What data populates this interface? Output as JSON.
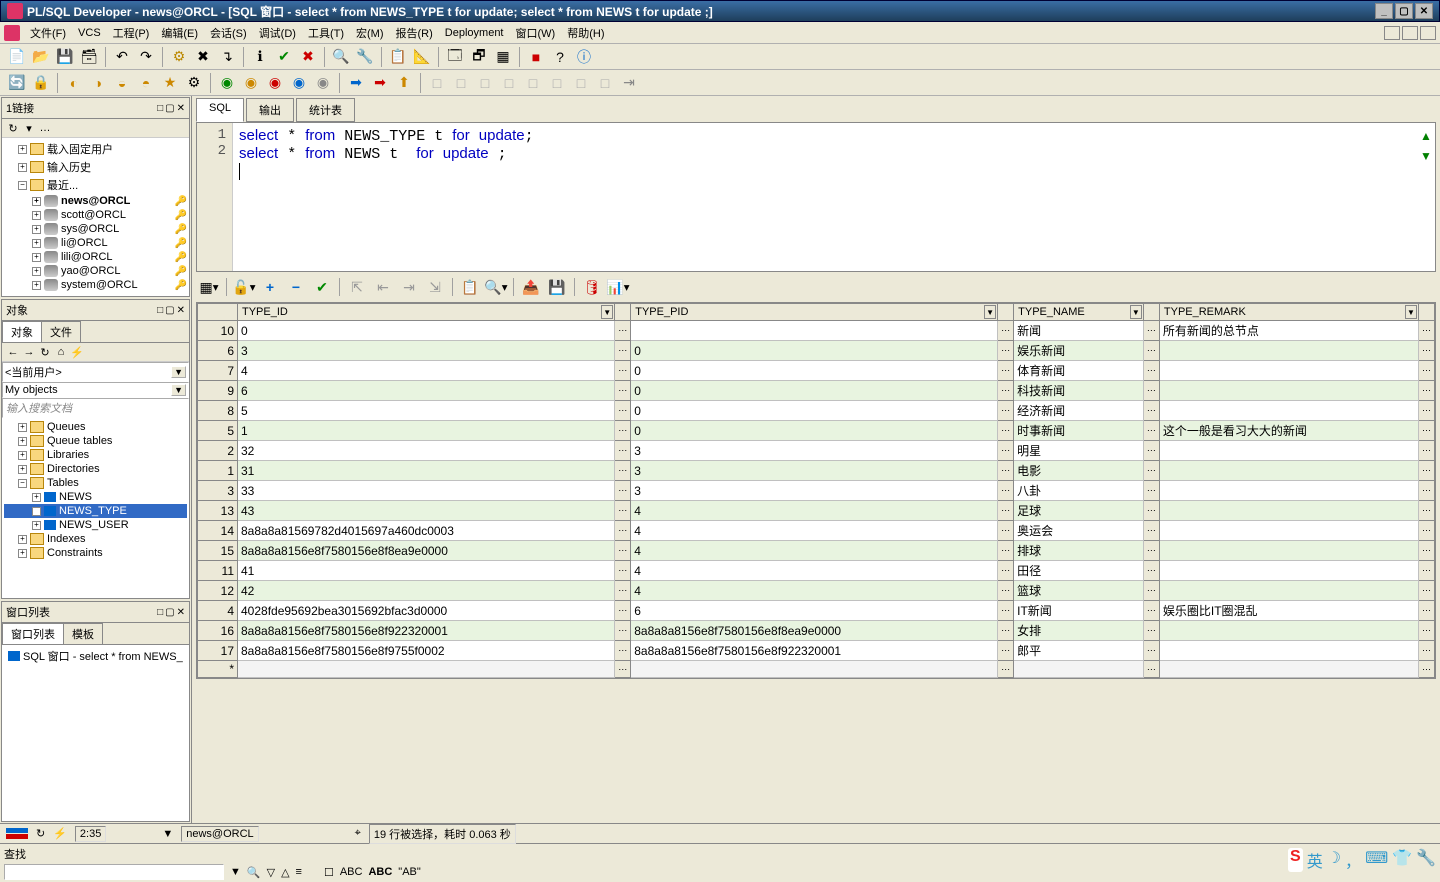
{
  "title": "PL/SQL Developer - news@ORCL - [SQL 窗口 - select * from NEWS_TYPE t for update; select * from NEWS t for update ;]",
  "menu": [
    "文件(F)",
    "VCS",
    "工程(P)",
    "编辑(E)",
    "会话(S)",
    "调试(D)",
    "工具(T)",
    "宏(M)",
    "报告(R)",
    "Deployment",
    "窗口(W)",
    "帮助(H)"
  ],
  "left": {
    "conn_title": "1链接",
    "conn_items": [
      {
        "label": "载入固定用户",
        "type": "folder"
      },
      {
        "label": "输入历史",
        "type": "folder"
      },
      {
        "label": "最近...",
        "type": "folder",
        "expanded": true,
        "children": [
          {
            "label": "news@ORCL",
            "bold": true,
            "key": true
          },
          {
            "label": "scott@ORCL",
            "key": true
          },
          {
            "label": "sys@ORCL",
            "key": true
          },
          {
            "label": "li@ORCL",
            "key": true
          },
          {
            "label": "lili@ORCL",
            "key": true
          },
          {
            "label": "yao@ORCL",
            "key": true
          },
          {
            "label": "system@ORCL",
            "key": true
          }
        ]
      }
    ],
    "obj_title": "对象",
    "obj_tabs": [
      "对象",
      "文件"
    ],
    "user_combo": "<当前用户>",
    "filter_combo": "My objects",
    "search_ph": "输入搜索文档",
    "tree": [
      {
        "label": "Queues"
      },
      {
        "label": "Queue tables"
      },
      {
        "label": "Libraries"
      },
      {
        "label": "Directories"
      },
      {
        "label": "Tables",
        "expanded": true,
        "children": [
          {
            "label": "NEWS"
          },
          {
            "label": "NEWS_TYPE",
            "sel": true
          },
          {
            "label": "NEWS_USER"
          }
        ]
      },
      {
        "label": "Indexes"
      },
      {
        "label": "Constraints"
      }
    ],
    "winlist_title": "窗口列表",
    "winlist_tabs": [
      "窗口列表",
      "模板"
    ],
    "winlist_item": "SQL 窗口 - select * from NEWS_"
  },
  "sql": {
    "tabs": [
      "SQL",
      "输出",
      "统计表"
    ],
    "lines": [
      {
        "num": 1,
        "tokens": [
          [
            "select",
            "kw"
          ],
          [
            " * ",
            ""
          ],
          [
            "from",
            "kw"
          ],
          [
            " NEWS_TYPE t ",
            ""
          ],
          [
            "for",
            "kw"
          ],
          [
            " ",
            ""
          ],
          [
            "update",
            "kw"
          ],
          [
            ";",
            ""
          ]
        ]
      },
      {
        "num": 2,
        "tokens": [
          [
            "select",
            "kw"
          ],
          [
            " * ",
            ""
          ],
          [
            "from",
            "kw"
          ],
          [
            " NEWS t  ",
            ""
          ],
          [
            "for",
            "kw"
          ],
          [
            " ",
            ""
          ],
          [
            "update",
            "kw"
          ],
          [
            " ;",
            ""
          ]
        ]
      }
    ]
  },
  "grid": {
    "columns": [
      "",
      "TYPE_ID",
      "TYPE_PID",
      "TYPE_NAME",
      "TYPE_REMARK"
    ],
    "rows": [
      {
        "n": 10,
        "id": "0",
        "pid": "",
        "name": "新闻",
        "remark": "所有新闻的总节点"
      },
      {
        "n": 6,
        "id": "3",
        "pid": "0",
        "name": "娱乐新闻",
        "remark": ""
      },
      {
        "n": 7,
        "id": "4",
        "pid": "0",
        "name": "体育新闻",
        "remark": ""
      },
      {
        "n": 9,
        "id": "6",
        "pid": "0",
        "name": "科技新闻",
        "remark": ""
      },
      {
        "n": 8,
        "id": "5",
        "pid": "0",
        "name": "经济新闻",
        "remark": ""
      },
      {
        "n": 5,
        "id": "1",
        "pid": "0",
        "name": "时事新闻",
        "remark": "这个一般是看习大大的新闻"
      },
      {
        "n": 2,
        "id": "32",
        "pid": "3",
        "name": "明星",
        "remark": ""
      },
      {
        "n": 1,
        "id": "31",
        "pid": "3",
        "name": "电影",
        "remark": ""
      },
      {
        "n": 3,
        "id": "33",
        "pid": "3",
        "name": "八卦",
        "remark": ""
      },
      {
        "n": 13,
        "id": "43",
        "pid": "4",
        "name": "足球",
        "remark": ""
      },
      {
        "n": 14,
        "id": "8a8a8a81569782d4015697a460dc0003",
        "pid": "4",
        "name": "奥运会",
        "remark": ""
      },
      {
        "n": 15,
        "id": "8a8a8a8156e8f7580156e8f8ea9e0000",
        "pid": "4",
        "name": "排球",
        "remark": ""
      },
      {
        "n": 11,
        "id": "41",
        "pid": "4",
        "name": "田径",
        "remark": ""
      },
      {
        "n": 12,
        "id": "42",
        "pid": "4",
        "name": "篮球",
        "remark": ""
      },
      {
        "n": 4,
        "id": "4028fde95692bea3015692bfac3d0000",
        "pid": "6",
        "name": "IT新闻",
        "remark": "娱乐圈比IT圈混乱"
      },
      {
        "n": 16,
        "id": "8a8a8a8156e8f7580156e8f922320001",
        "pid": "8a8a8a8156e8f7580156e8f8ea9e0000",
        "name": "女排",
        "remark": ""
      },
      {
        "n": 17,
        "id": "8a8a8a8156e8f7580156e8f9755f0002",
        "pid": "8a8a8a8156e8f7580156e8f922320001",
        "name": "郎平",
        "remark": ""
      }
    ]
  },
  "status": {
    "time": "2:35",
    "conn": "news@ORCL",
    "msg": "19 行被选择，耗时 0.063 秒"
  },
  "search": {
    "label": "查找",
    "regex_label": "\"AB\""
  }
}
